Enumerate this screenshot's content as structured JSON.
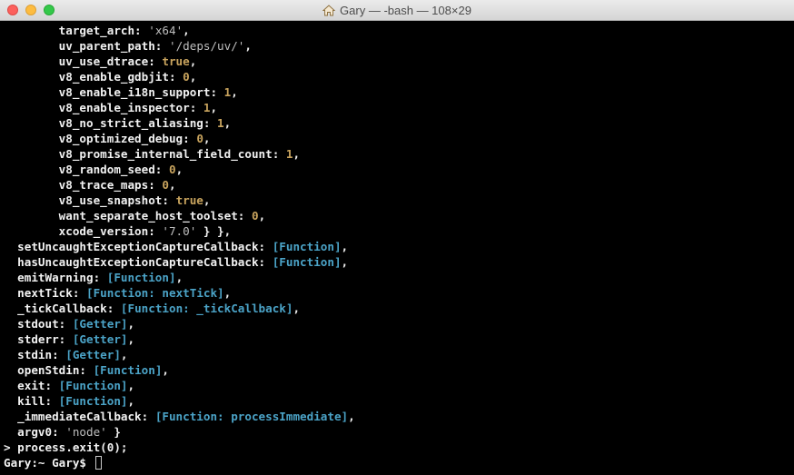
{
  "window": {
    "title": "Gary — -bash — 108×29",
    "title_icon": "home-icon",
    "buttons": [
      "close-button",
      "minimize-button",
      "zoom-button"
    ]
  },
  "colors": {
    "background": "#000000",
    "text": "#f2f2f2",
    "string": "#bdbdbd",
    "number": "#c9a45e",
    "function": "#4ba3c7"
  },
  "terminal": {
    "lines": [
      [
        {
          "t": "        target_arch: ",
          "c": "p"
        },
        {
          "t": "'x64'",
          "c": "s"
        },
        {
          "t": ",",
          "c": "p"
        }
      ],
      [
        {
          "t": "        uv_parent_path: ",
          "c": "p"
        },
        {
          "t": "'/deps/uv/'",
          "c": "s"
        },
        {
          "t": ",",
          "c": "p"
        }
      ],
      [
        {
          "t": "        uv_use_dtrace: ",
          "c": "p"
        },
        {
          "t": "true",
          "c": "b"
        },
        {
          "t": ",",
          "c": "p"
        }
      ],
      [
        {
          "t": "        v8_enable_gdbjit: ",
          "c": "p"
        },
        {
          "t": "0",
          "c": "n"
        },
        {
          "t": ",",
          "c": "p"
        }
      ],
      [
        {
          "t": "        v8_enable_i18n_support: ",
          "c": "p"
        },
        {
          "t": "1",
          "c": "n"
        },
        {
          "t": ",",
          "c": "p"
        }
      ],
      [
        {
          "t": "        v8_enable_inspector: ",
          "c": "p"
        },
        {
          "t": "1",
          "c": "n"
        },
        {
          "t": ",",
          "c": "p"
        }
      ],
      [
        {
          "t": "        v8_no_strict_aliasing: ",
          "c": "p"
        },
        {
          "t": "1",
          "c": "n"
        },
        {
          "t": ",",
          "c": "p"
        }
      ],
      [
        {
          "t": "        v8_optimized_debug: ",
          "c": "p"
        },
        {
          "t": "0",
          "c": "n"
        },
        {
          "t": ",",
          "c": "p"
        }
      ],
      [
        {
          "t": "        v8_promise_internal_field_count: ",
          "c": "p"
        },
        {
          "t": "1",
          "c": "n"
        },
        {
          "t": ",",
          "c": "p"
        }
      ],
      [
        {
          "t": "        v8_random_seed: ",
          "c": "p"
        },
        {
          "t": "0",
          "c": "n"
        },
        {
          "t": ",",
          "c": "p"
        }
      ],
      [
        {
          "t": "        v8_trace_maps: ",
          "c": "p"
        },
        {
          "t": "0",
          "c": "n"
        },
        {
          "t": ",",
          "c": "p"
        }
      ],
      [
        {
          "t": "        v8_use_snapshot: ",
          "c": "p"
        },
        {
          "t": "true",
          "c": "b"
        },
        {
          "t": ",",
          "c": "p"
        }
      ],
      [
        {
          "t": "        want_separate_host_toolset: ",
          "c": "p"
        },
        {
          "t": "0",
          "c": "n"
        },
        {
          "t": ",",
          "c": "p"
        }
      ],
      [
        {
          "t": "        xcode_version: ",
          "c": "p"
        },
        {
          "t": "'7.0'",
          "c": "s"
        },
        {
          "t": " } },",
          "c": "p"
        }
      ],
      [
        {
          "t": "  setUncaughtExceptionCaptureCallback: ",
          "c": "p"
        },
        {
          "t": "[Function]",
          "c": "f"
        },
        {
          "t": ",",
          "c": "p"
        }
      ],
      [
        {
          "t": "  hasUncaughtExceptionCaptureCallback: ",
          "c": "p"
        },
        {
          "t": "[Function]",
          "c": "f"
        },
        {
          "t": ",",
          "c": "p"
        }
      ],
      [
        {
          "t": "  emitWarning: ",
          "c": "p"
        },
        {
          "t": "[Function]",
          "c": "f"
        },
        {
          "t": ",",
          "c": "p"
        }
      ],
      [
        {
          "t": "  nextTick: ",
          "c": "p"
        },
        {
          "t": "[Function: nextTick]",
          "c": "f"
        },
        {
          "t": ",",
          "c": "p"
        }
      ],
      [
        {
          "t": "  _tickCallback: ",
          "c": "p"
        },
        {
          "t": "[Function: _tickCallback]",
          "c": "f"
        },
        {
          "t": ",",
          "c": "p"
        }
      ],
      [
        {
          "t": "  stdout: ",
          "c": "p"
        },
        {
          "t": "[Getter]",
          "c": "g"
        },
        {
          "t": ",",
          "c": "p"
        }
      ],
      [
        {
          "t": "  stderr: ",
          "c": "p"
        },
        {
          "t": "[Getter]",
          "c": "g"
        },
        {
          "t": ",",
          "c": "p"
        }
      ],
      [
        {
          "t": "  stdin: ",
          "c": "p"
        },
        {
          "t": "[Getter]",
          "c": "g"
        },
        {
          "t": ",",
          "c": "p"
        }
      ],
      [
        {
          "t": "  openStdin: ",
          "c": "p"
        },
        {
          "t": "[Function]",
          "c": "f"
        },
        {
          "t": ",",
          "c": "p"
        }
      ],
      [
        {
          "t": "  exit: ",
          "c": "p"
        },
        {
          "t": "[Function]",
          "c": "f"
        },
        {
          "t": ",",
          "c": "p"
        }
      ],
      [
        {
          "t": "  kill: ",
          "c": "p"
        },
        {
          "t": "[Function]",
          "c": "f"
        },
        {
          "t": ",",
          "c": "p"
        }
      ],
      [
        {
          "t": "  _immediateCallback: ",
          "c": "p"
        },
        {
          "t": "[Function: processImmediate]",
          "c": "f"
        },
        {
          "t": ",",
          "c": "p"
        }
      ],
      [
        {
          "t": "  argv0: ",
          "c": "p"
        },
        {
          "t": "'node'",
          "c": "s"
        },
        {
          "t": " }",
          "c": "p"
        }
      ],
      [
        {
          "t": "> process.exit(0);",
          "c": "p"
        }
      ]
    ],
    "prompt": "Gary:~ Gary$ "
  }
}
